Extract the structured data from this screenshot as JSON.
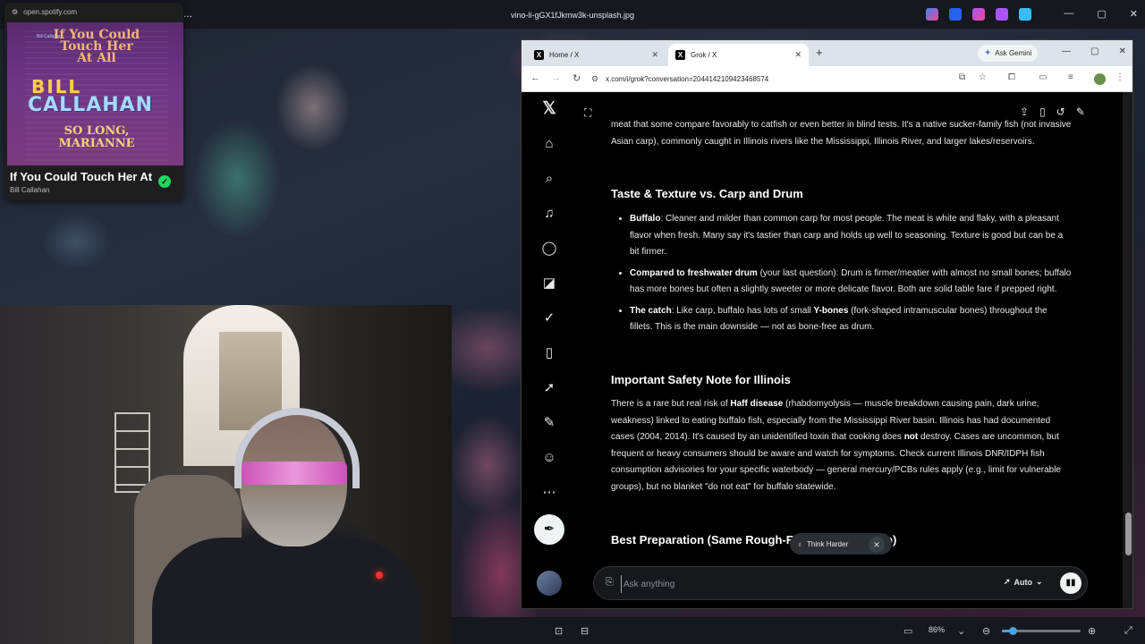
{
  "viewer": {
    "file_title": "vino-li-gGX1fJkmw3k-unsplash.jpg",
    "more_label": "...",
    "zoom_level": "86%",
    "zoom_fraction": 0.14
  },
  "mini_player": {
    "url": "open.spotify.com",
    "cover_small_text": "Bill Callahan",
    "cover_line1": "If You Could Touch Her At All",
    "cover_bill": "BILL",
    "cover_callahan": "CALLAHAN",
    "cover_solong": "SO LONG, MARIANNE",
    "title": "If You Could Touch Her At All",
    "artist": "Bill Callahan"
  },
  "browser": {
    "tabs": [
      {
        "label": "Home / X"
      },
      {
        "label": "Grok / X"
      }
    ],
    "gemini_label": "Ask Gemini",
    "url": "x.com/i/grok?conversation=2044142109423468574"
  },
  "grok": {
    "intro": "meat that some compare favorably to catfish or even better in blind tests. It's a native sucker-family fish (not invasive Asian carp), commonly caught in Illinois rivers like the Mississippi, Illinois River, and larger lakes/reservoirs.",
    "h1": "Taste & Texture vs. Carp and Drum",
    "b1_strong": "Buffalo",
    "b1_text": ": Cleaner and milder than common carp for most people. The meat is white and flaky, with a pleasant flavor when fresh. Many say it's tastier than carp and holds up well to seasoning. Texture is good but can be a bit firmer.",
    "b2_strong": "Compared to freshwater drum",
    "b2_text": " (your last question): Drum is firmer/meatier with almost no small bones; buffalo has more bones but often a slightly sweeter or more delicate flavor. Both are solid table fare if prepped right.",
    "b3_strong": "The catch",
    "b3_text_a": ": Like carp, buffalo has lots of small ",
    "b3_strong2": "Y-bones",
    "b3_text_b": " (fork-shaped intramuscular bones) throughout the fillets. This is the main downside — not as bone-free as drum.",
    "h2": "Important Safety Note for Illinois",
    "p2_a": "There is a rare but real risk of ",
    "p2_strong": "Haff disease",
    "p2_b": " (rhabdomyolysis — muscle breakdown causing pain, dark urine, weakness) linked to eating buffalo fish, especially from the Mississippi River basin. Illinois has had documented cases (2004, 2014). It's caused by an unidentified toxin that cooking does ",
    "p2_strong2": "not",
    "p2_c": " destroy. Cases are uncommon, but frequent or heavy consumers should be aware and watch for symptoms. Check current Illinois DNR/IDPH fish consumption advisories for your specific waterbody — general mercury/PCBs rules apply (e.g., limit for vulnerable groups), but no blanket \"do not eat\" for buffalo statewide.",
    "h3": "Best Preparation (Same Rough-Fish Tricks as Carp)",
    "think_label": "Think Harder",
    "composer_placeholder": "Ask anything",
    "model_label": "Auto"
  },
  "colors": {
    "x_background": "#000000",
    "spotify_green": "#1ed760",
    "accent_blue": "#4aa3df"
  }
}
